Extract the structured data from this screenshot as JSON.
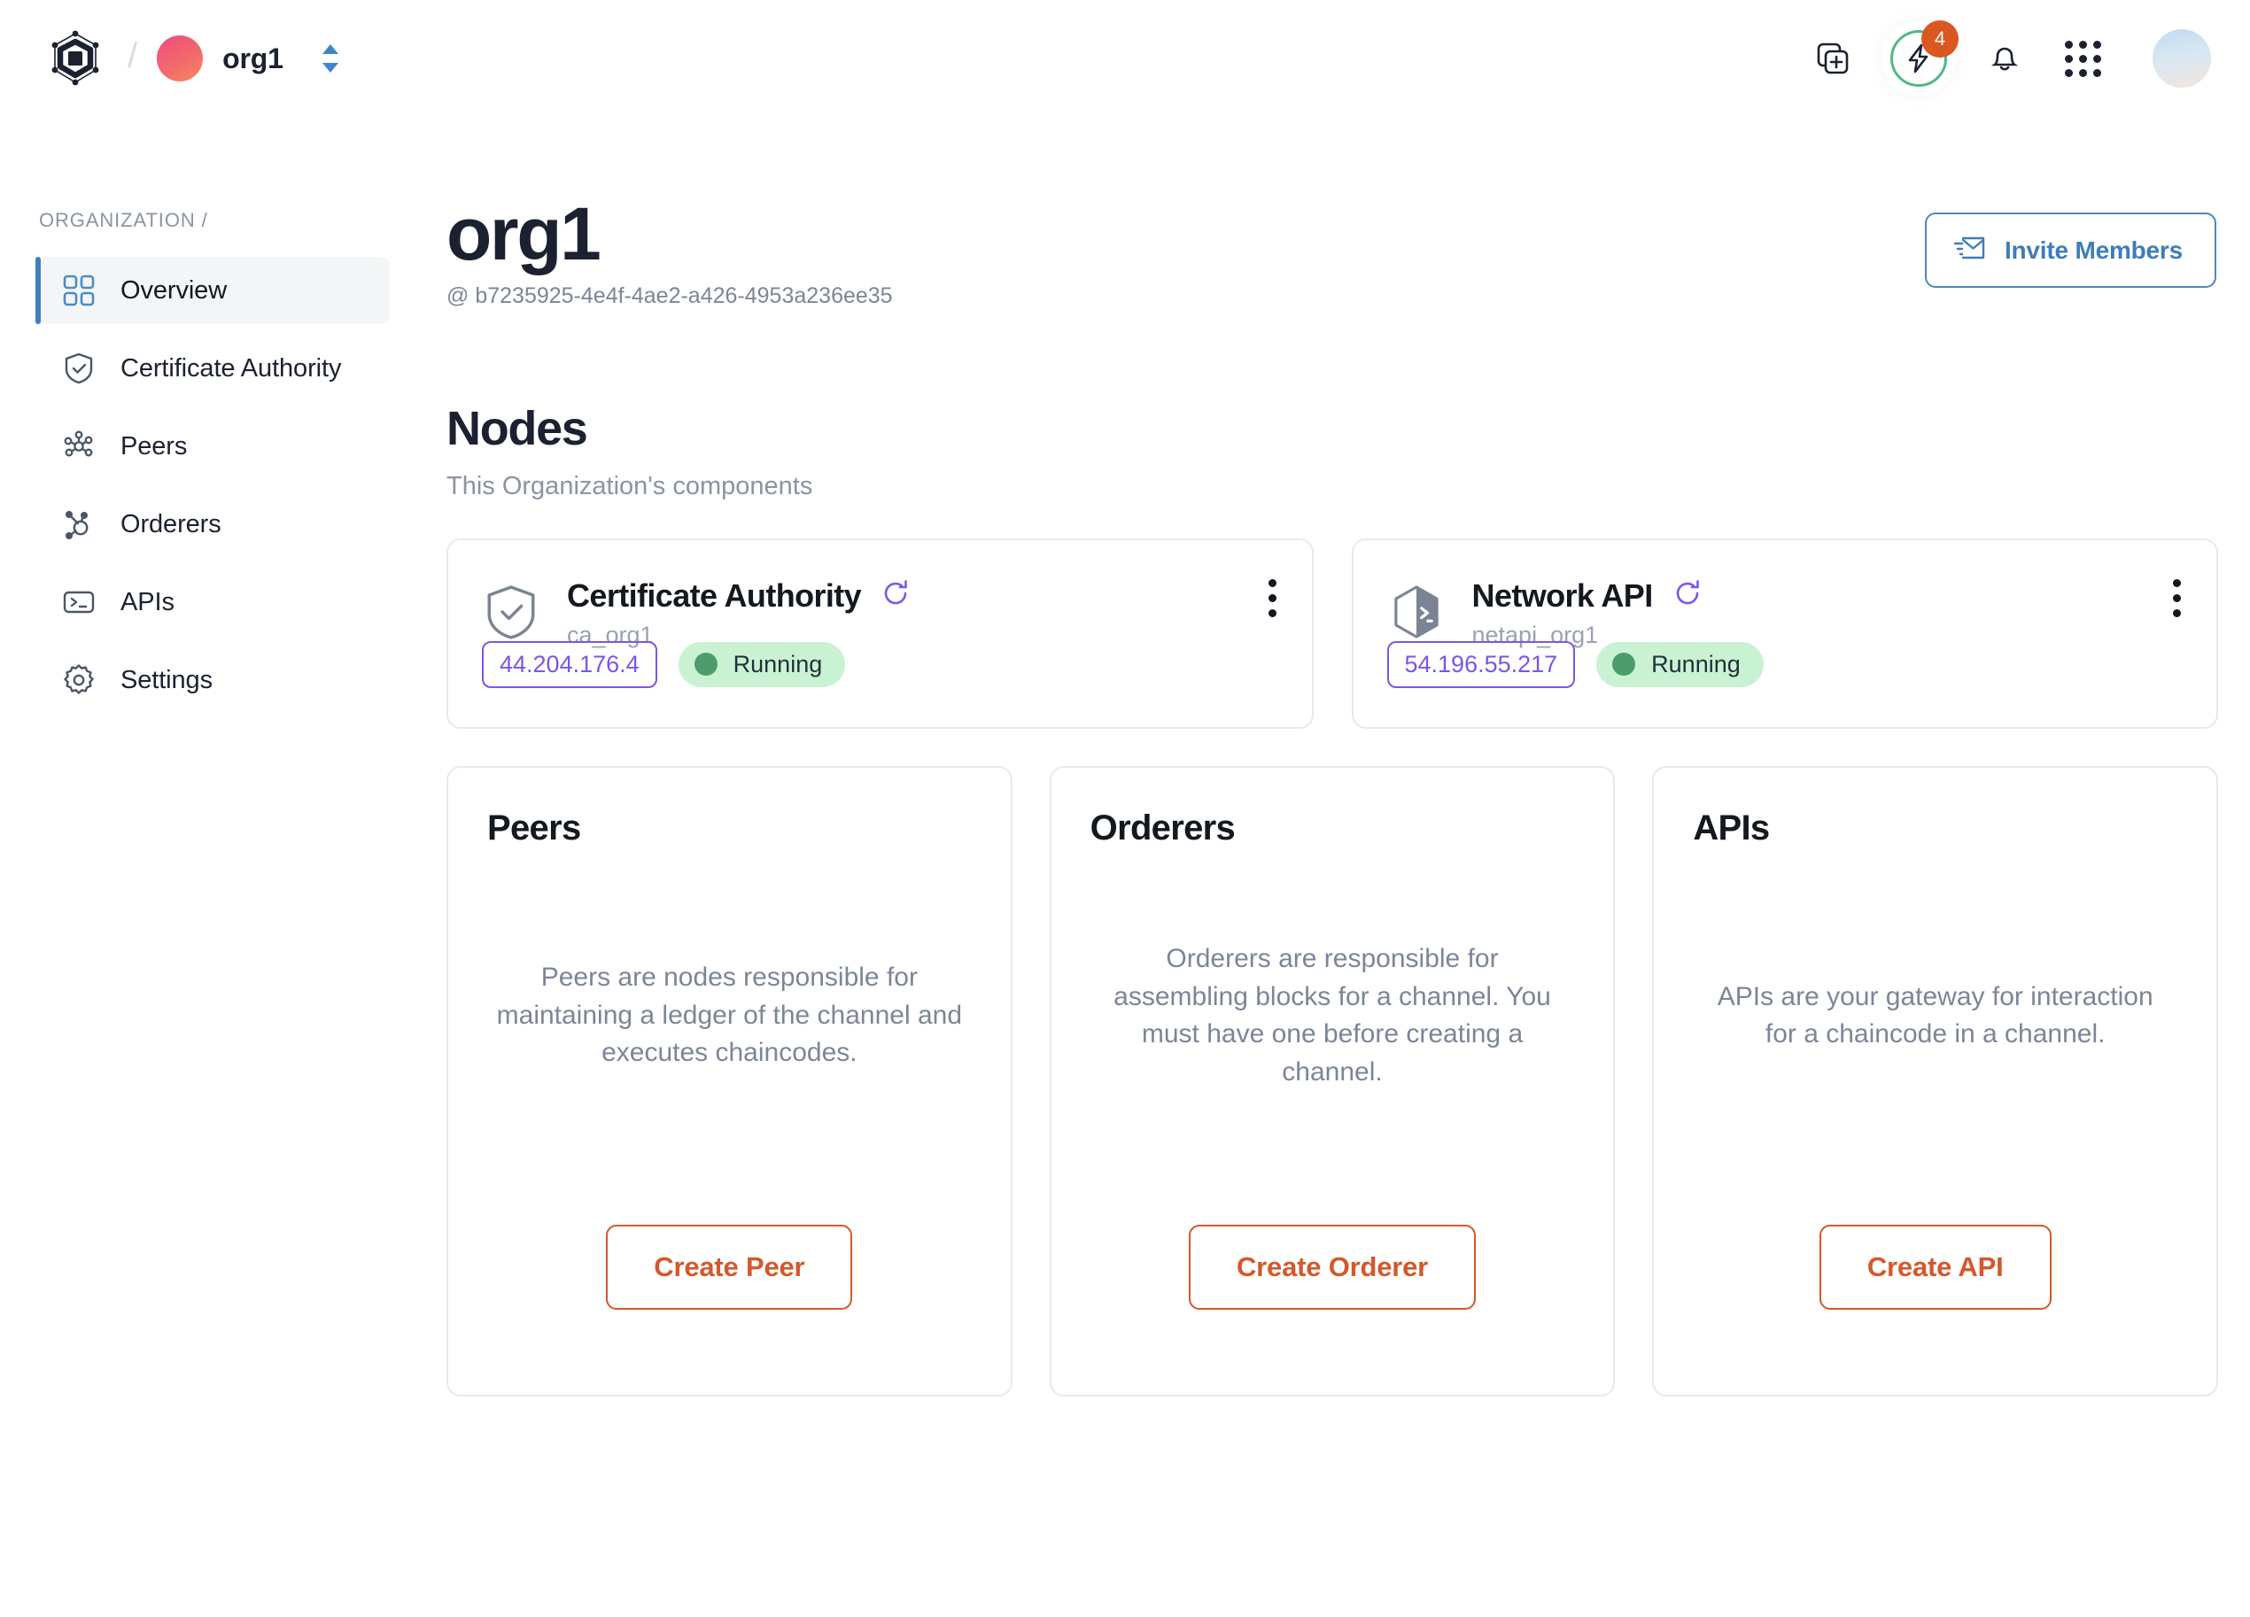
{
  "topbar": {
    "brand_icon": "hexagon-cube-logo",
    "separator": "/",
    "org_name": "org1",
    "org_switcher_icon": "chevron-up-down-icon",
    "add_icon": "add-to-stack-icon",
    "bolt_icon": "lightning-bolt-icon",
    "bolt_badge_count": "4",
    "bell_icon": "bell-icon",
    "apps_icon": "apps-grid-icon",
    "avatar_icon": "user-avatar"
  },
  "sidebar": {
    "kicker": "ORGANIZATION /",
    "items": [
      {
        "label": "Overview",
        "icon": "grid-squares-icon",
        "active": true
      },
      {
        "label": "Certificate Authority",
        "icon": "shield-check-icon",
        "active": false
      },
      {
        "label": "Peers",
        "icon": "nodes-network-icon",
        "active": false
      },
      {
        "label": "Orderers",
        "icon": "orderer-hub-icon",
        "active": false
      },
      {
        "label": "APIs",
        "icon": "terminal-prompt-icon",
        "active": false
      },
      {
        "label": "Settings",
        "icon": "gear-icon",
        "active": false
      }
    ]
  },
  "page": {
    "title": "org1",
    "subtitle": "@ b7235925-4e4f-4ae2-a426-4953a236ee35",
    "invite_button": {
      "label": "Invite Members",
      "icon": "mail-send-icon"
    }
  },
  "nodes_section": {
    "title": "Nodes",
    "subtitle": "This Organization's components"
  },
  "node_cards": [
    {
      "title": "Certificate Authority",
      "icon": "shield-check-icon",
      "refresh_icon": "refresh-icon",
      "menu_icon": "kebab-menu-icon",
      "name": "ca_org1",
      "ip": "44.204.176.4",
      "status": "Running"
    },
    {
      "title": "Network API",
      "icon": "cube-terminal-icon",
      "refresh_icon": "refresh-icon",
      "menu_icon": "kebab-menu-icon",
      "name": "netapi_org1",
      "ip": "54.196.55.217",
      "status": "Running"
    }
  ],
  "cta_cards": [
    {
      "title": "Peers",
      "description": "Peers are nodes responsible for maintaining a ledger of the channel and executes chaincodes.",
      "button": "Create Peer"
    },
    {
      "title": "Orderers",
      "description": "Orderers are responsible for assembling blocks for a channel. You must have one before creating a channel.",
      "button": "Create Orderer"
    },
    {
      "title": "APIs",
      "description": "APIs are your gateway for interaction for a chaincode in a channel.",
      "button": "Create API"
    }
  ],
  "colors": {
    "accent_blue": "#3f7fc1",
    "accent_orange": "#d4582a",
    "status_green_bg": "#c9f2d2",
    "status_green_dot": "#4e9c6b",
    "ip_purple": "#7b55e6",
    "badge_orange": "#d9581f",
    "bolt_ring_green": "#52b788",
    "text_dark": "#1b2130",
    "text_muted": "#8b93a3",
    "card_border": "#e6e9ef"
  }
}
